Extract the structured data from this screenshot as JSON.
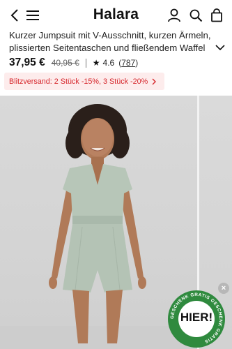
{
  "header": {
    "brand": "Halara",
    "icons": [
      "chevron-left-icon",
      "menu-icon",
      "user-icon",
      "search-icon",
      "shopping-bag-icon"
    ]
  },
  "product": {
    "title": "Kurzer Jumpsuit mit V-Ausschnitt, kurzen Ärmeln, plissierten Seitentaschen und fließendem Waffel",
    "price": "37,95 €",
    "old_price": "40,95 €",
    "rating_icon": "star-icon",
    "rating": "4.6",
    "review_count": "787"
  },
  "banner": {
    "text": "Blitzversand: 2 Stück -15%, 3 Stück -20%"
  },
  "gift_badge": {
    "ring_text": "GESCHENK GRATIS GESCHENK GRATIS",
    "label": "HIER!",
    "close_icon": "close-icon"
  },
  "colors": {
    "sale_red": "#d6262b",
    "banner_bg": "#fdecec",
    "badge_green": "#2f8a3e"
  }
}
